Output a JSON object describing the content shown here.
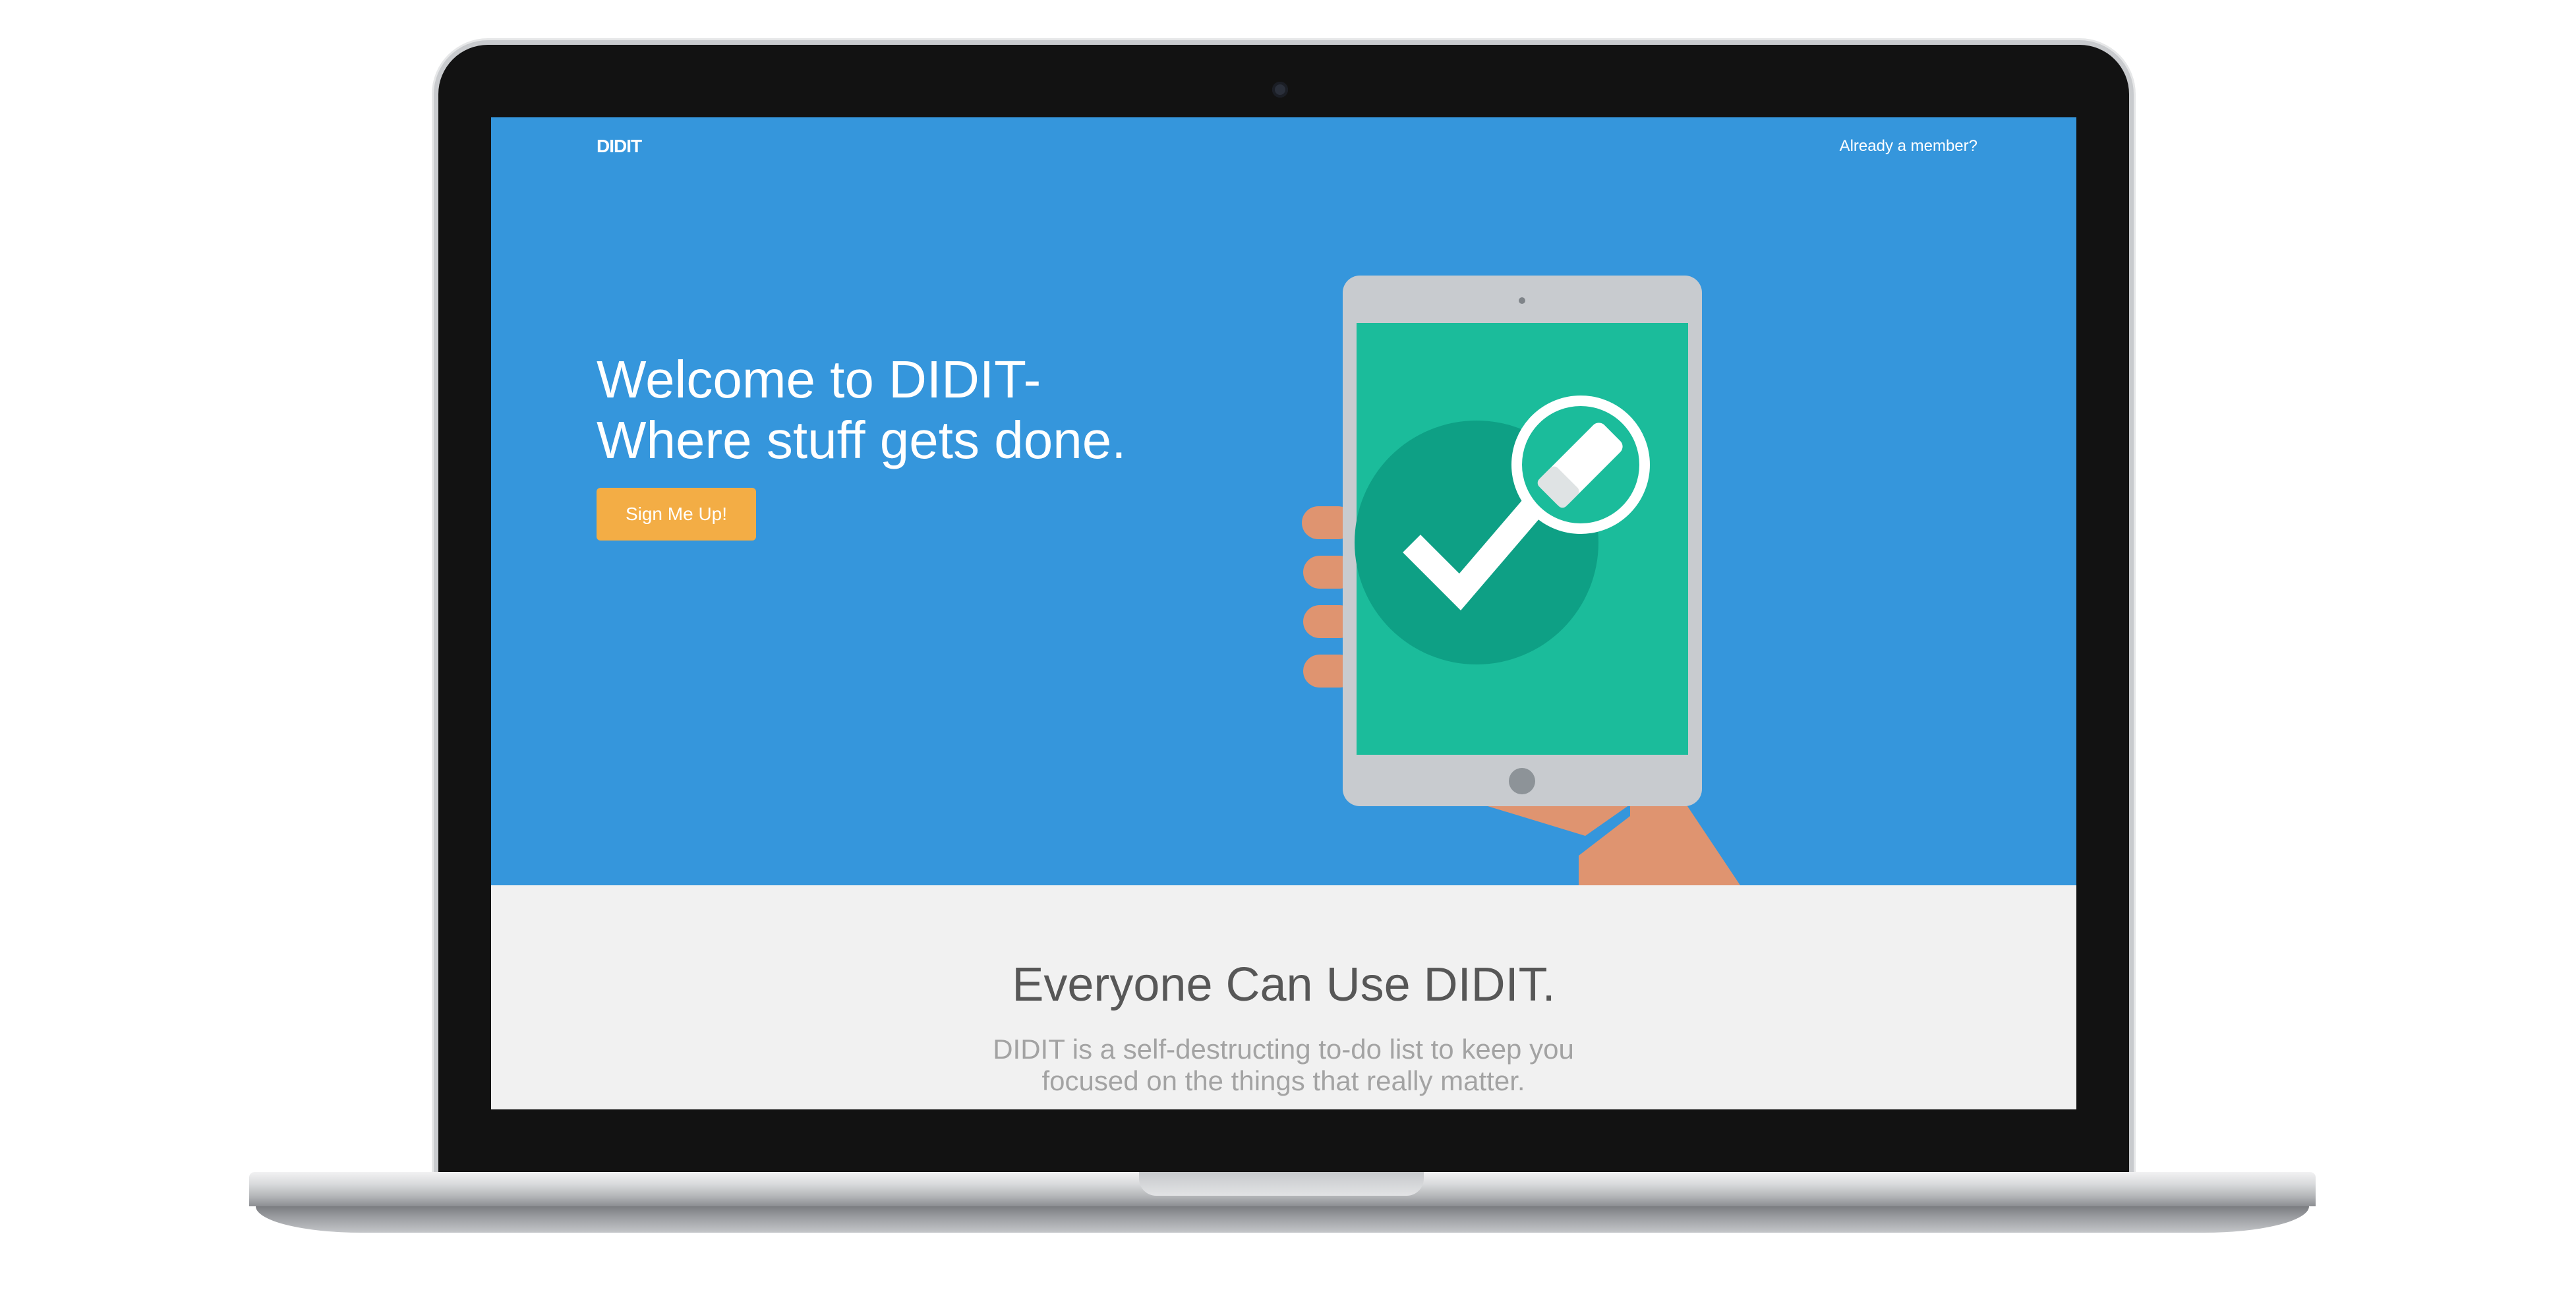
{
  "nav": {
    "logo": "DIDIT",
    "member_link": "Already a member?"
  },
  "hero": {
    "headline_line1": "Welcome to DIDIT-",
    "headline_line2": "Where stuff gets done.",
    "cta_label": "Sign Me Up!"
  },
  "section": {
    "title": "Everyone Can Use DIDIT.",
    "description": "DIDIT is a self-destructing to-do list to keep you focused on the things that really matter."
  },
  "colors": {
    "hero_background": "#3596dc",
    "cta_button": "#f3ad45",
    "lower_background": "#f1f1f1",
    "tablet_screen": "#1bbc9b",
    "check_circle": "#0ea085",
    "hand": "#df9470",
    "tablet_frame": "#c8cbcf"
  },
  "icons": {
    "illustration": "hand-holding-tablet-checkmark",
    "eraser": "eraser-icon",
    "check": "check-icon"
  }
}
